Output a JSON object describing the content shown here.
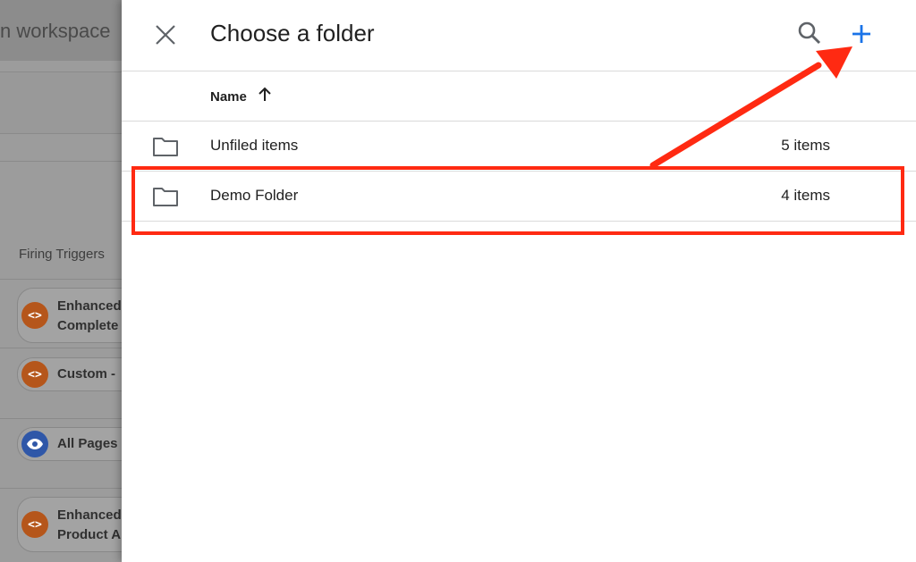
{
  "background": {
    "workspace_text": "n workspace",
    "firing_label": "Firing Triggers",
    "triggers": [
      {
        "line1": "Enhanced",
        "line2": "Complete",
        "icon": "code-icon",
        "color": "#b5561b"
      },
      {
        "line1": "Custom -",
        "line2": "",
        "icon": "code-icon",
        "color": "#b5561b"
      },
      {
        "line1": "All Pages",
        "line2": "",
        "icon": "eye-icon",
        "color": "#2f57a8"
      },
      {
        "line1": "Enhanced",
        "line2": "Product A",
        "icon": "code-icon",
        "color": "#b5561b"
      }
    ]
  },
  "dialog": {
    "title": "Choose a folder",
    "close_icon": "close-icon",
    "search_icon": "search-icon",
    "add_icon": "plus-icon",
    "column_header": {
      "name_label": "Name",
      "sort_icon": "arrow-up-icon"
    },
    "rows": [
      {
        "name": "Unfiled items",
        "count": "5 items",
        "icon": "folder-icon"
      },
      {
        "name": "Demo Folder",
        "count": "4 items",
        "icon": "folder-icon"
      }
    ]
  },
  "annotation": {
    "color": "#ff2a12",
    "highlighted_row": "Demo Folder",
    "arrow_target": "add-button"
  },
  "colors": {
    "accent": "#1a73e8",
    "icon_gray": "#5f6368",
    "text": "#212121"
  }
}
